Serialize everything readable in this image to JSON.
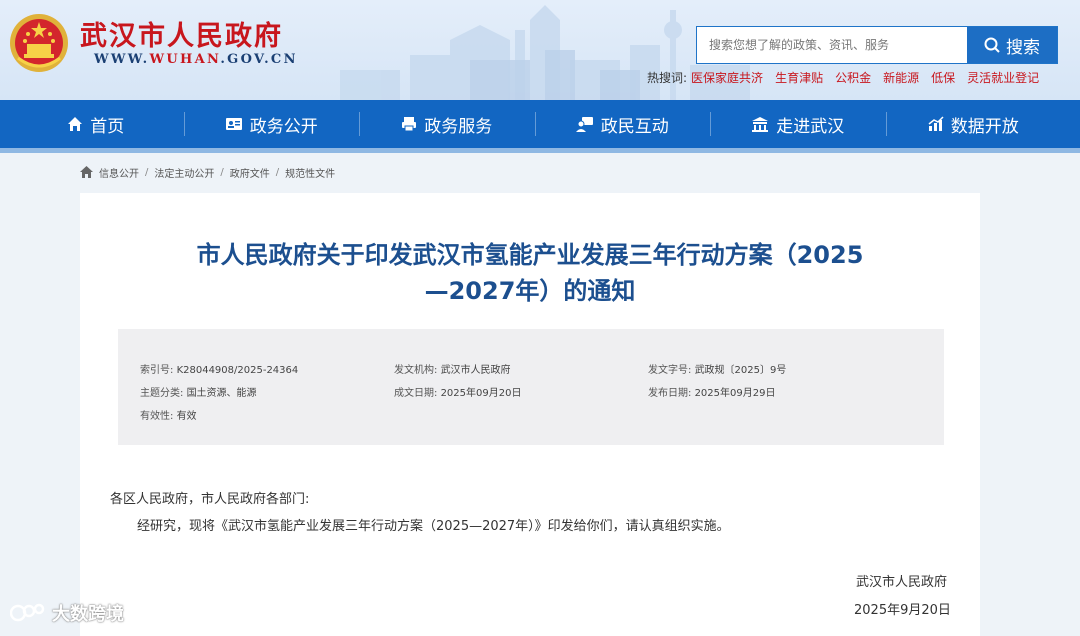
{
  "header": {
    "site_title": "武汉市人民政府",
    "site_url_prefix": "WWW.",
    "site_url_highlight": "WUHAN",
    "site_url_suffix": ".GOV.CN",
    "search_placeholder": "搜索您想了解的政策、资讯、服务",
    "search_button": "搜索",
    "hot_label": "热搜词:",
    "hot_words": [
      "医保家庭共济",
      "生育津贴",
      "公积金",
      "新能源",
      "低保",
      "灵活就业登记"
    ]
  },
  "nav": {
    "items": [
      {
        "label": "首页",
        "icon": "home-icon"
      },
      {
        "label": "政务公开",
        "icon": "id-card-icon"
      },
      {
        "label": "政务服务",
        "icon": "printer-icon"
      },
      {
        "label": "政民互动",
        "icon": "chat-user-icon"
      },
      {
        "label": "走进武汉",
        "icon": "building-icon"
      },
      {
        "label": "数据开放",
        "icon": "chart-icon"
      }
    ]
  },
  "breadcrumb": [
    "信息公开",
    "法定主动公开",
    "政府文件",
    "规范性文件"
  ],
  "document": {
    "title_line1": "市人民政府关于印发武汉市氢能产业发展三年行动方案（2025",
    "title_line2": "—2027年）的通知",
    "meta": {
      "index_label": "索引号:",
      "index_value": "K28044908/2025-24364",
      "issuer_label": "发文机构:",
      "issuer_value": "武汉市人民政府",
      "doc_no_label": "发文字号:",
      "doc_no_value": "武政规〔2025〕9号",
      "topic_label": "主题分类:",
      "topic_value": "国土资源、能源",
      "created_label": "成文日期:",
      "created_value": "2025年09月20日",
      "published_label": "发布日期:",
      "published_value": "2025年09月29日",
      "validity_label": "有效性:",
      "validity_value": "有效"
    },
    "salutation": "各区人民政府，市人民政府各部门:",
    "body": "经研究，现将《武汉市氢能产业发展三年行动方案（2025—2027年）》印发给你们，请认真组织实施。",
    "signature": "武汉市人民政府",
    "date": "2025年9月20日"
  },
  "watermark": "大数跨境",
  "colors": {
    "brand_red": "#c8161d",
    "nav_blue": "#1266c2",
    "title_blue": "#1c4f8f"
  }
}
